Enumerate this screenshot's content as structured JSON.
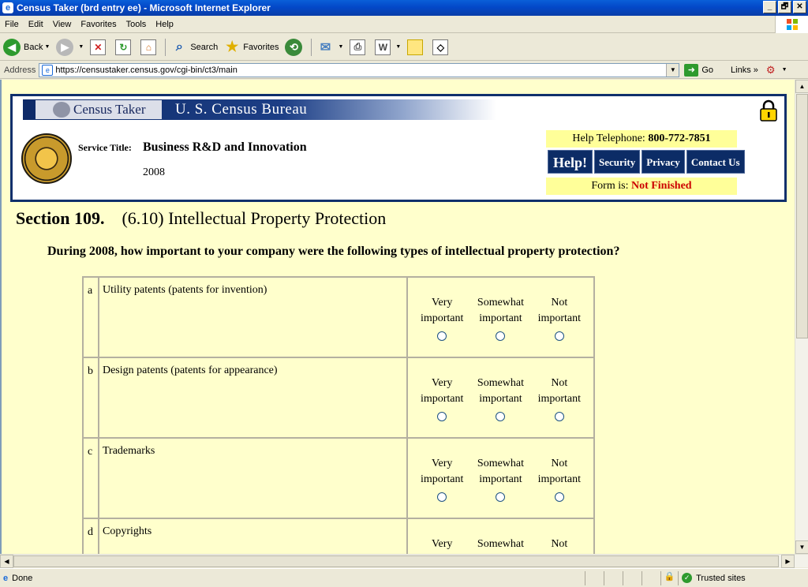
{
  "window": {
    "title": "Census Taker (brd entry ee) - Microsoft Internet Explorer",
    "controls": [
      "_",
      "🗗",
      "✕"
    ]
  },
  "menu": [
    "File",
    "Edit",
    "View",
    "Favorites",
    "Tools",
    "Help"
  ],
  "toolbar": {
    "back_label": "Back",
    "search_label": "Search",
    "favorites_label": "Favorites"
  },
  "address": {
    "label": "Address",
    "url": "https://censustaker.census.gov/cgi-bin/ct3/main",
    "go_label": "Go",
    "links_label": "Links"
  },
  "header": {
    "brand": "Census Taker",
    "agency": "U. S. Census Bureau",
    "service_title_label": "Service Title:",
    "service_title": "Business R&D and Innovation",
    "year": "2008",
    "help_tel_label": "Help Telephone:",
    "help_tel": "800-772-7851",
    "nav": [
      "Help!",
      "Security",
      "Privacy",
      "Contact Us"
    ],
    "form_status_label": "Form is:",
    "form_status": "Not Finished"
  },
  "section": {
    "number": "Section 109.",
    "name": "(6.10) Intellectual Property Protection",
    "question": "During 2008, how important to your company were the following types of intellectual property protection?"
  },
  "rows": [
    {
      "letter": "a",
      "label": "Utility patents (patents for invention)"
    },
    {
      "letter": "b",
      "label": "Design patents (patents for appearance)"
    },
    {
      "letter": "c",
      "label": "Trademarks"
    },
    {
      "letter": "d",
      "label": "Copyrights"
    }
  ],
  "options": [
    {
      "line1": "Very",
      "line2": "important"
    },
    {
      "line1": "Somewhat",
      "line2": "important"
    },
    {
      "line1": "Not",
      "line2": "important"
    }
  ],
  "status": {
    "text": "Done",
    "zone": "Trusted sites"
  }
}
